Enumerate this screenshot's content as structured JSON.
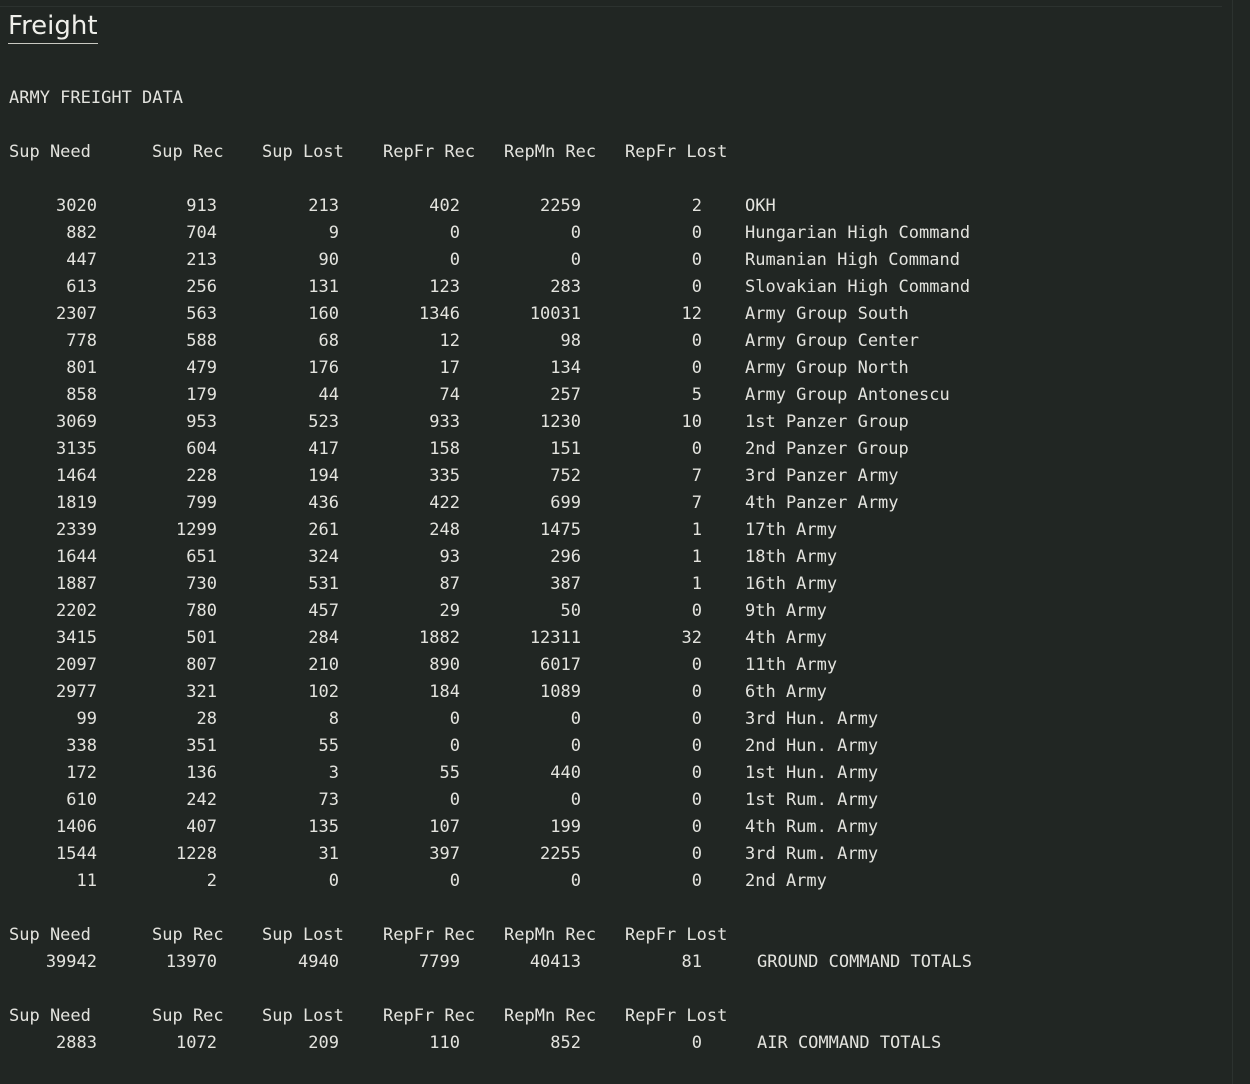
{
  "page": {
    "title": "Freight",
    "section_title": "ARMY FREIGHT DATA"
  },
  "headers": [
    "Sup Need",
    "Sup Rec",
    "Sup Lost",
    "RepFr Rec",
    "RepMn Rec",
    "RepFr Lost"
  ],
  "army_rows": [
    {
      "sup_need": "3020",
      "sup_rec": "913",
      "sup_lost": "213",
      "repfr_rec": "402",
      "repmn_rec": "2259",
      "repfr_lost": "2",
      "name": "OKH"
    },
    {
      "sup_need": "882",
      "sup_rec": "704",
      "sup_lost": "9",
      "repfr_rec": "0",
      "repmn_rec": "0",
      "repfr_lost": "0",
      "name": "Hungarian High Command"
    },
    {
      "sup_need": "447",
      "sup_rec": "213",
      "sup_lost": "90",
      "repfr_rec": "0",
      "repmn_rec": "0",
      "repfr_lost": "0",
      "name": "Rumanian High Command"
    },
    {
      "sup_need": "613",
      "sup_rec": "256",
      "sup_lost": "131",
      "repfr_rec": "123",
      "repmn_rec": "283",
      "repfr_lost": "0",
      "name": "Slovakian High Command"
    },
    {
      "sup_need": "2307",
      "sup_rec": "563",
      "sup_lost": "160",
      "repfr_rec": "1346",
      "repmn_rec": "10031",
      "repfr_lost": "12",
      "name": "Army Group South"
    },
    {
      "sup_need": "778",
      "sup_rec": "588",
      "sup_lost": "68",
      "repfr_rec": "12",
      "repmn_rec": "98",
      "repfr_lost": "0",
      "name": "Army Group Center"
    },
    {
      "sup_need": "801",
      "sup_rec": "479",
      "sup_lost": "176",
      "repfr_rec": "17",
      "repmn_rec": "134",
      "repfr_lost": "0",
      "name": "Army Group North"
    },
    {
      "sup_need": "858",
      "sup_rec": "179",
      "sup_lost": "44",
      "repfr_rec": "74",
      "repmn_rec": "257",
      "repfr_lost": "5",
      "name": "Army Group Antonescu"
    },
    {
      "sup_need": "3069",
      "sup_rec": "953",
      "sup_lost": "523",
      "repfr_rec": "933",
      "repmn_rec": "1230",
      "repfr_lost": "10",
      "name": "1st Panzer Group"
    },
    {
      "sup_need": "3135",
      "sup_rec": "604",
      "sup_lost": "417",
      "repfr_rec": "158",
      "repmn_rec": "151",
      "repfr_lost": "0",
      "name": "2nd Panzer Group"
    },
    {
      "sup_need": "1464",
      "sup_rec": "228",
      "sup_lost": "194",
      "repfr_rec": "335",
      "repmn_rec": "752",
      "repfr_lost": "7",
      "name": "3rd Panzer Army"
    },
    {
      "sup_need": "1819",
      "sup_rec": "799",
      "sup_lost": "436",
      "repfr_rec": "422",
      "repmn_rec": "699",
      "repfr_lost": "7",
      "name": "4th Panzer Army"
    },
    {
      "sup_need": "2339",
      "sup_rec": "1299",
      "sup_lost": "261",
      "repfr_rec": "248",
      "repmn_rec": "1475",
      "repfr_lost": "1",
      "name": "17th Army"
    },
    {
      "sup_need": "1644",
      "sup_rec": "651",
      "sup_lost": "324",
      "repfr_rec": "93",
      "repmn_rec": "296",
      "repfr_lost": "1",
      "name": "18th Army"
    },
    {
      "sup_need": "1887",
      "sup_rec": "730",
      "sup_lost": "531",
      "repfr_rec": "87",
      "repmn_rec": "387",
      "repfr_lost": "1",
      "name": "16th Army"
    },
    {
      "sup_need": "2202",
      "sup_rec": "780",
      "sup_lost": "457",
      "repfr_rec": "29",
      "repmn_rec": "50",
      "repfr_lost": "0",
      "name": "9th Army"
    },
    {
      "sup_need": "3415",
      "sup_rec": "501",
      "sup_lost": "284",
      "repfr_rec": "1882",
      "repmn_rec": "12311",
      "repfr_lost": "32",
      "name": "4th Army"
    },
    {
      "sup_need": "2097",
      "sup_rec": "807",
      "sup_lost": "210",
      "repfr_rec": "890",
      "repmn_rec": "6017",
      "repfr_lost": "0",
      "name": "11th Army"
    },
    {
      "sup_need": "2977",
      "sup_rec": "321",
      "sup_lost": "102",
      "repfr_rec": "184",
      "repmn_rec": "1089",
      "repfr_lost": "0",
      "name": "6th Army"
    },
    {
      "sup_need": "99",
      "sup_rec": "28",
      "sup_lost": "8",
      "repfr_rec": "0",
      "repmn_rec": "0",
      "repfr_lost": "0",
      "name": "3rd Hun. Army"
    },
    {
      "sup_need": "338",
      "sup_rec": "351",
      "sup_lost": "55",
      "repfr_rec": "0",
      "repmn_rec": "0",
      "repfr_lost": "0",
      "name": "2nd Hun. Army"
    },
    {
      "sup_need": "172",
      "sup_rec": "136",
      "sup_lost": "3",
      "repfr_rec": "55",
      "repmn_rec": "440",
      "repfr_lost": "0",
      "name": "1st Hun. Army"
    },
    {
      "sup_need": "610",
      "sup_rec": "242",
      "sup_lost": "73",
      "repfr_rec": "0",
      "repmn_rec": "0",
      "repfr_lost": "0",
      "name": "1st Rum. Army"
    },
    {
      "sup_need": "1406",
      "sup_rec": "407",
      "sup_lost": "135",
      "repfr_rec": "107",
      "repmn_rec": "199",
      "repfr_lost": "0",
      "name": "4th Rum. Army"
    },
    {
      "sup_need": "1544",
      "sup_rec": "1228",
      "sup_lost": "31",
      "repfr_rec": "397",
      "repmn_rec": "2255",
      "repfr_lost": "0",
      "name": "3rd Rum. Army"
    },
    {
      "sup_need": "11",
      "sup_rec": "2",
      "sup_lost": "0",
      "repfr_rec": "0",
      "repmn_rec": "0",
      "repfr_lost": "0",
      "name": "2nd Army"
    }
  ],
  "ground_totals": {
    "sup_need": "39942",
    "sup_rec": "13970",
    "sup_lost": "4940",
    "repfr_rec": "7799",
    "repmn_rec": "40413",
    "repfr_lost": "81",
    "name": "GROUND COMMAND TOTALS"
  },
  "air_totals": {
    "sup_need": "2883",
    "sup_rec": "1072",
    "sup_lost": "209",
    "repfr_rec": "110",
    "repmn_rec": "852",
    "repfr_lost": "0",
    "name": "AIR COMMAND TOTALS"
  }
}
